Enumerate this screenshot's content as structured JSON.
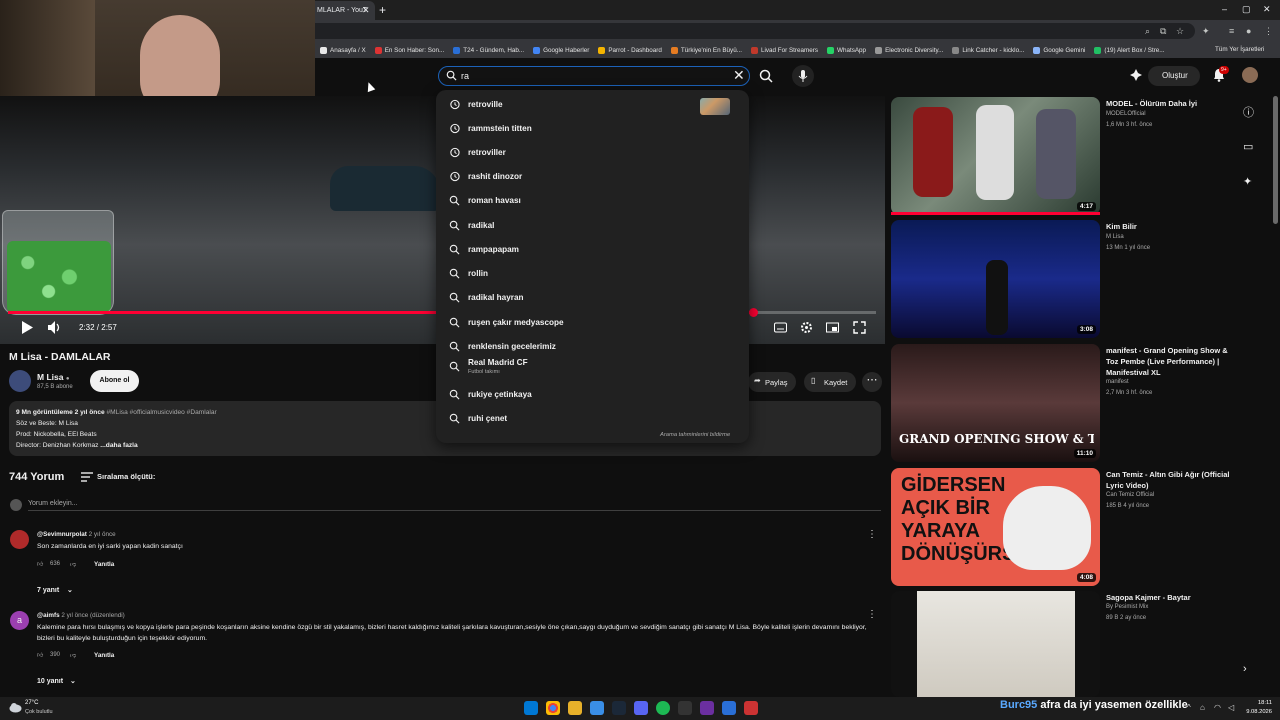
{
  "browser": {
    "tab_title": "MLALAR - YouT",
    "bookmarks": [
      "Anasayfa / X",
      "En Son Haber: Son...",
      "T24 - Gündem, Hab...",
      "Google Haberler",
      "Parrot - Dashboard",
      "Türkiye'nin En Büyü...",
      "Livad For Streamers",
      "WhatsApp",
      "Electronic Diversity...",
      "Link Catcher - kicklo...",
      "Google Gemini",
      "(19) Alert Box / Stre..."
    ],
    "bookmark_colors": [
      "#e8e8e8",
      "#d33",
      "#2a6fd6",
      "#4285f4",
      "#f4b400",
      "#e67c22",
      "#c0392b",
      "#25d366",
      "#999",
      "#888",
      "#8ab4f8",
      "#21c064"
    ],
    "all_bookmarks": "Tüm Yer İşaretleri"
  },
  "search": {
    "query": "ra",
    "report_label": "Arama tahminlerini bildirme",
    "suggestions": [
      {
        "text": "retroville",
        "type": "history"
      },
      {
        "text": "rammstein titten",
        "type": "history"
      },
      {
        "text": "retroviller",
        "type": "history"
      },
      {
        "text": "rashit dinozor",
        "type": "history"
      },
      {
        "text": "roman havası",
        "type": "search"
      },
      {
        "text": "radikal",
        "type": "search"
      },
      {
        "text": "rampapapam",
        "type": "search"
      },
      {
        "text": "rollin",
        "type": "search"
      },
      {
        "text": "radikal hayran",
        "type": "search"
      },
      {
        "text": "ruşen çakır medyascope",
        "type": "search"
      },
      {
        "text": "renklensin gecelerimiz",
        "type": "search"
      },
      {
        "text": "Real Madrid CF",
        "type": "search",
        "subtitle": "Futbol takımı"
      },
      {
        "text": "rukiye çetinkaya",
        "type": "search"
      },
      {
        "text": "ruhi çenet",
        "type": "search"
      }
    ]
  },
  "masthead": {
    "create_label": "Oluştur",
    "notif_badge": "9+"
  },
  "player": {
    "time": "2:32 / 2:57",
    "progress_fraction": 0.859
  },
  "video": {
    "title": "M Lisa - DAMLALAR",
    "channel": "M Lisa",
    "subscribers": "87,5 B abone",
    "subscribe_label": "Abone ol",
    "share_label": "Paylaş",
    "save_label": "Kaydet",
    "desc_stats": "9 Mn görüntüleme  2 yıl önce",
    "desc_tags": "#MLisa #officialmusicvideo #Damlalar",
    "desc_line2": "Söz ve Beste: M Lisa",
    "desc_line3": "Prod: Nickobella, EEl Beats",
    "desc_line4": "Director: Denizhan Korkmaz",
    "desc_more": "...daha fazla"
  },
  "comments": {
    "count": "744 Yorum",
    "sort_label": "Sıralama ölçütü:",
    "placeholder": "Yorum ekleyin...",
    "items": [
      {
        "user": "@Sevimnurpolat",
        "when": "2 yıl önce",
        "text": "Son zamanlarda en iyi sarki yapan kadin sanatçı",
        "likes": "636",
        "reply_label": "Yanıtla",
        "replies": "7 yanıt"
      },
      {
        "user": "@aimfs",
        "when": "2 yıl önce (düzenlendi)",
        "text": "Kalemine para hırsı bulaşmış ve kopya işlerle para peşinde koşanların aksine kendine özgü bir stil yakalamış, bizleri hasret kaldığımız kaliteli şarkılara kavuşturan,sesiyle öne çıkan,saygı duyduğum ve sevdiğim sanatçı gibi sanatçı M Lisa. Böyle kaliteli işlerin devamını bekliyor, bizleri bu kaliteyle buluşturduğun için teşekkür ediyorum.",
        "likes": "390",
        "reply_label": "Yanıtla",
        "replies": "10 yanıt"
      }
    ]
  },
  "related": [
    {
      "title": "MODEL - Ölürüm Daha İyi",
      "channel": "MODELOfficial",
      "meta": "1,6 Mn  3 hf. önce",
      "duration": "4:17"
    },
    {
      "title": "Kim Bilir",
      "channel": "M Lisa",
      "meta": "13 Mn  1 yıl önce",
      "duration": "3:08"
    },
    {
      "title": "manifest - Grand Opening Show & Toz Pembe (Live Performance) | Manifestival XL",
      "channel": "manifest",
      "meta": "2,7 Mn  3 hf. önce",
      "duration": "11:10",
      "thumb_text": "GRAND OPENING SHOW & TOZ PEMBE"
    },
    {
      "title": "Can Temiz - Altın Gibi Ağır (Official Lyric Video)",
      "channel": "Can Temiz Official",
      "meta": "185 B  4 yıl önce",
      "duration": "4:08",
      "thumb_text": "GİDERSEN AÇIK BİR YARAYA DÖNÜŞÜRSÜN"
    },
    {
      "title": "Sagopa Kajmer - Baytar",
      "channel": "By Pesimist Mix",
      "meta": "89 B  2 ay önce",
      "duration": ""
    }
  ],
  "taskbar": {
    "temp": "27°C",
    "weather": "Çok bulutlu",
    "ticker_user": "Burc95",
    "ticker_text": "afra da iyi yasemen özellikle",
    "time": "18:11",
    "date": "9.08.2026"
  },
  "colors": {
    "accent": "#ff0033",
    "search_border": "#1c62b9"
  }
}
